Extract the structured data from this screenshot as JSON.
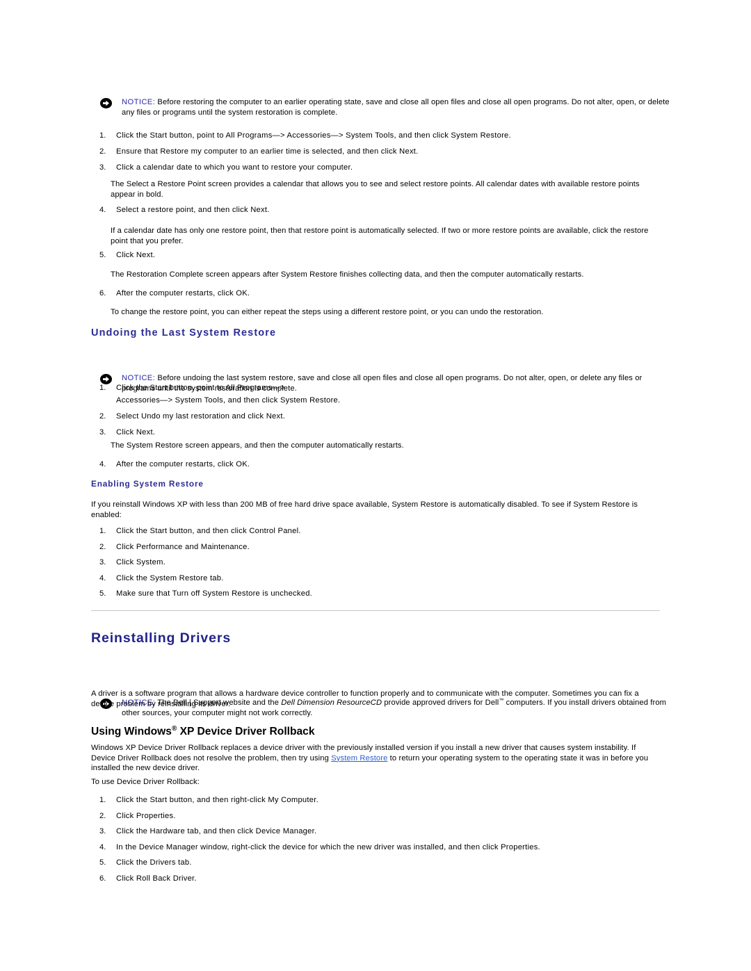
{
  "document": {
    "notices": {
      "label": "NOTICE:",
      "restore_warning": "Before restoring the computer to an earlier operating state, save and close all open files and close all open programs. Do not alter, open, or delete any files or programs until the system restoration is complete.",
      "undo_warning": "Before undoing the last system restore, save and close all open files and close all open programs. Do not alter, open, or delete any files or programs until the system restoration is complete.",
      "drivers_warning_before": "The Dell | Support website and the ",
      "drivers_warning_italic": "Dell Dimension ResourceCD",
      "drivers_warning_middle": " provide approved drivers for Dell",
      "drivers_warning_tm": "™",
      "drivers_warning_after": " computers. If you install drivers obtained from other sources, your computer might not work correctly."
    },
    "system_restore_steps": [
      "Click the Start button, point to All Programs—> Accessories—> System Tools, and then click System Restore.",
      "Ensure that Restore my computer to an earlier time is selected, and then click Next.",
      "Click a calendar date to which you want to restore your computer."
    ],
    "system_restore_steps_cont": [
      "Select a restore point, and then click Next."
    ],
    "system_restore_steps_cont2": [
      "Click Next."
    ],
    "system_restore_steps_cont3": [
      "After the computer restarts, click OK."
    ],
    "paragraphs": {
      "select_restore_point": "The Select a Restore Point screen provides a calendar that allows you to see and select restore points. All calendar dates with available restore points appear in bold.",
      "calendar_date_note": "If a calendar date has only one restore point, then that restore point is automatically selected. If two or more restore points are available, click the restore point that you prefer.",
      "restoration_complete": "The Restoration Complete screen appears after System Restore finishes collecting data, and then the computer automatically restarts.",
      "change_restore_point": "To change the restore point, you can either repeat the steps using a different restore point, or you can undo the restoration.",
      "system_restore_screen": "The System Restore screen appears, and then the computer automatically restarts.",
      "enabling_intro": "If you reinstall Windows XP with less than 200 MB of free hard drive space available, System Restore is automatically disabled. To see if System Restore is enabled:",
      "driver_definition": "A driver is a software program that allows a hardware device controller to function properly and to communicate with the computer. Sometimes you can fix a device problem by reinstalling its driver.",
      "rollback_intro_part1": "Windows XP Device Driver Rollback replaces a device driver with the previously installed version if you install a new driver that causes system instability. If Device Driver Rollback does not resolve the problem, then try using ",
      "rollback_link": "System Restore",
      "rollback_intro_part2": " to return your operating system to the operating state it was in before you installed the new device driver.",
      "to_use_rollback": "To use Device Driver Rollback:"
    },
    "headings": {
      "undoing_last_system_restore": "Undoing the Last System Restore",
      "enabling_system_restore": "Enabling System Restore",
      "reinstalling_drivers": "Reinstalling Drivers",
      "using_windows_xp_rollback_part1": "Using Windows",
      "using_windows_xp_rollback_reg": "®",
      "using_windows_xp_rollback_part2": " XP Device Driver Rollback"
    },
    "undo_steps": [
      "Click the Start button, point to All Programs—>",
      "Accessories—> System Tools, and then click System Restore.",
      "Select Undo my last restoration and click Next.",
      "Click Next."
    ],
    "undo_steps_cont": [
      "After the computer restarts, click OK."
    ],
    "enabling_steps": [
      "Click the Start button, and then click Control Panel.",
      "Click Performance and Maintenance.",
      "Click System.",
      "Click the System Restore tab.",
      "Make sure that Turn off System Restore is unchecked."
    ],
    "rollback_steps": [
      "Click the Start button, and then right-click My Computer.",
      "Click Properties.",
      "Click the Hardware tab, and then click Device Manager.",
      "In the Device Manager window, right-click the device for which the new driver was installed, and then click Properties.",
      "Click the Drivers tab.",
      "Click Roll Back Driver."
    ],
    "numbers": {
      "n1": "1.",
      "n2": "2.",
      "n3": "3.",
      "n4": "4.",
      "n5": "5.",
      "n6": "6."
    },
    "colors": {
      "heading_blue": "#22228c",
      "notice_label_blue": "#2a2aaa",
      "link_blue": "#2a5fd4",
      "rule_gray": "#c8c8c8"
    }
  }
}
